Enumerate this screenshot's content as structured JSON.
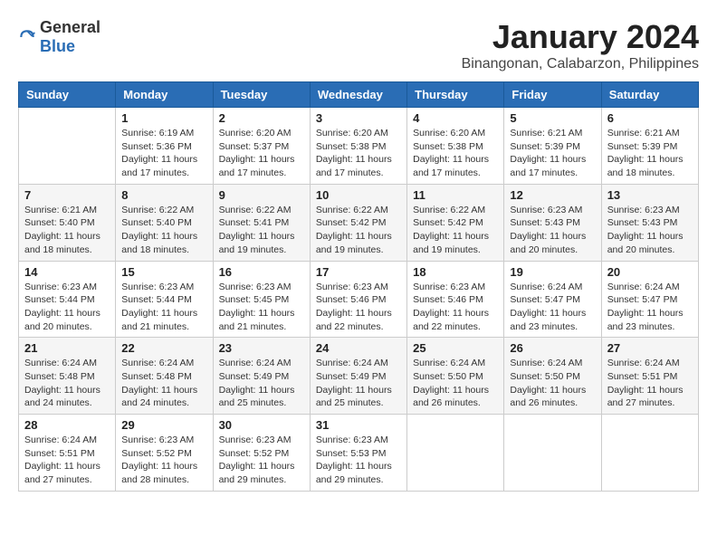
{
  "header": {
    "logo_general": "General",
    "logo_blue": "Blue",
    "month_title": "January 2024",
    "location": "Binangonan, Calabarzon, Philippines"
  },
  "calendar": {
    "weekdays": [
      "Sunday",
      "Monday",
      "Tuesday",
      "Wednesday",
      "Thursday",
      "Friday",
      "Saturday"
    ],
    "weeks": [
      [
        {
          "day": "",
          "info": ""
        },
        {
          "day": "1",
          "info": "Sunrise: 6:19 AM\nSunset: 5:36 PM\nDaylight: 11 hours\nand 17 minutes."
        },
        {
          "day": "2",
          "info": "Sunrise: 6:20 AM\nSunset: 5:37 PM\nDaylight: 11 hours\nand 17 minutes."
        },
        {
          "day": "3",
          "info": "Sunrise: 6:20 AM\nSunset: 5:38 PM\nDaylight: 11 hours\nand 17 minutes."
        },
        {
          "day": "4",
          "info": "Sunrise: 6:20 AM\nSunset: 5:38 PM\nDaylight: 11 hours\nand 17 minutes."
        },
        {
          "day": "5",
          "info": "Sunrise: 6:21 AM\nSunset: 5:39 PM\nDaylight: 11 hours\nand 17 minutes."
        },
        {
          "day": "6",
          "info": "Sunrise: 6:21 AM\nSunset: 5:39 PM\nDaylight: 11 hours\nand 18 minutes."
        }
      ],
      [
        {
          "day": "7",
          "info": "Sunrise: 6:21 AM\nSunset: 5:40 PM\nDaylight: 11 hours\nand 18 minutes."
        },
        {
          "day": "8",
          "info": "Sunrise: 6:22 AM\nSunset: 5:40 PM\nDaylight: 11 hours\nand 18 minutes."
        },
        {
          "day": "9",
          "info": "Sunrise: 6:22 AM\nSunset: 5:41 PM\nDaylight: 11 hours\nand 19 minutes."
        },
        {
          "day": "10",
          "info": "Sunrise: 6:22 AM\nSunset: 5:42 PM\nDaylight: 11 hours\nand 19 minutes."
        },
        {
          "day": "11",
          "info": "Sunrise: 6:22 AM\nSunset: 5:42 PM\nDaylight: 11 hours\nand 19 minutes."
        },
        {
          "day": "12",
          "info": "Sunrise: 6:23 AM\nSunset: 5:43 PM\nDaylight: 11 hours\nand 20 minutes."
        },
        {
          "day": "13",
          "info": "Sunrise: 6:23 AM\nSunset: 5:43 PM\nDaylight: 11 hours\nand 20 minutes."
        }
      ],
      [
        {
          "day": "14",
          "info": "Sunrise: 6:23 AM\nSunset: 5:44 PM\nDaylight: 11 hours\nand 20 minutes."
        },
        {
          "day": "15",
          "info": "Sunrise: 6:23 AM\nSunset: 5:44 PM\nDaylight: 11 hours\nand 21 minutes."
        },
        {
          "day": "16",
          "info": "Sunrise: 6:23 AM\nSunset: 5:45 PM\nDaylight: 11 hours\nand 21 minutes."
        },
        {
          "day": "17",
          "info": "Sunrise: 6:23 AM\nSunset: 5:46 PM\nDaylight: 11 hours\nand 22 minutes."
        },
        {
          "day": "18",
          "info": "Sunrise: 6:23 AM\nSunset: 5:46 PM\nDaylight: 11 hours\nand 22 minutes."
        },
        {
          "day": "19",
          "info": "Sunrise: 6:24 AM\nSunset: 5:47 PM\nDaylight: 11 hours\nand 23 minutes."
        },
        {
          "day": "20",
          "info": "Sunrise: 6:24 AM\nSunset: 5:47 PM\nDaylight: 11 hours\nand 23 minutes."
        }
      ],
      [
        {
          "day": "21",
          "info": "Sunrise: 6:24 AM\nSunset: 5:48 PM\nDaylight: 11 hours\nand 24 minutes."
        },
        {
          "day": "22",
          "info": "Sunrise: 6:24 AM\nSunset: 5:48 PM\nDaylight: 11 hours\nand 24 minutes."
        },
        {
          "day": "23",
          "info": "Sunrise: 6:24 AM\nSunset: 5:49 PM\nDaylight: 11 hours\nand 25 minutes."
        },
        {
          "day": "24",
          "info": "Sunrise: 6:24 AM\nSunset: 5:49 PM\nDaylight: 11 hours\nand 25 minutes."
        },
        {
          "day": "25",
          "info": "Sunrise: 6:24 AM\nSunset: 5:50 PM\nDaylight: 11 hours\nand 26 minutes."
        },
        {
          "day": "26",
          "info": "Sunrise: 6:24 AM\nSunset: 5:50 PM\nDaylight: 11 hours\nand 26 minutes."
        },
        {
          "day": "27",
          "info": "Sunrise: 6:24 AM\nSunset: 5:51 PM\nDaylight: 11 hours\nand 27 minutes."
        }
      ],
      [
        {
          "day": "28",
          "info": "Sunrise: 6:24 AM\nSunset: 5:51 PM\nDaylight: 11 hours\nand 27 minutes."
        },
        {
          "day": "29",
          "info": "Sunrise: 6:23 AM\nSunset: 5:52 PM\nDaylight: 11 hours\nand 28 minutes."
        },
        {
          "day": "30",
          "info": "Sunrise: 6:23 AM\nSunset: 5:52 PM\nDaylight: 11 hours\nand 29 minutes."
        },
        {
          "day": "31",
          "info": "Sunrise: 6:23 AM\nSunset: 5:53 PM\nDaylight: 11 hours\nand 29 minutes."
        },
        {
          "day": "",
          "info": ""
        },
        {
          "day": "",
          "info": ""
        },
        {
          "day": "",
          "info": ""
        }
      ]
    ]
  }
}
